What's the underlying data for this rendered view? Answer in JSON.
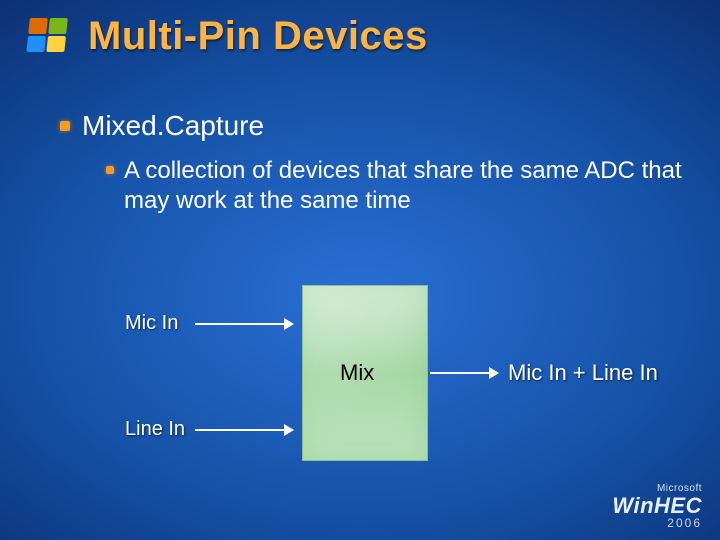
{
  "title": "Multi-Pin Devices",
  "bullets": {
    "level1": "Mixed.Capture",
    "level2": "A collection of devices that share the same ADC that may work at the same time"
  },
  "diagram": {
    "mic_in": "Mic In",
    "line_in": "Line In",
    "mix": "Mix",
    "output": "Mic In + Line In"
  },
  "footer": {
    "microsoft": "Microsoft",
    "brand_prefix": "Win",
    "brand_suffix": "HEC",
    "year": "2006"
  },
  "colors": {
    "accent": "#ffb340",
    "bullet": "#ff9a1f",
    "mix_fill": "#bfe3bf"
  }
}
